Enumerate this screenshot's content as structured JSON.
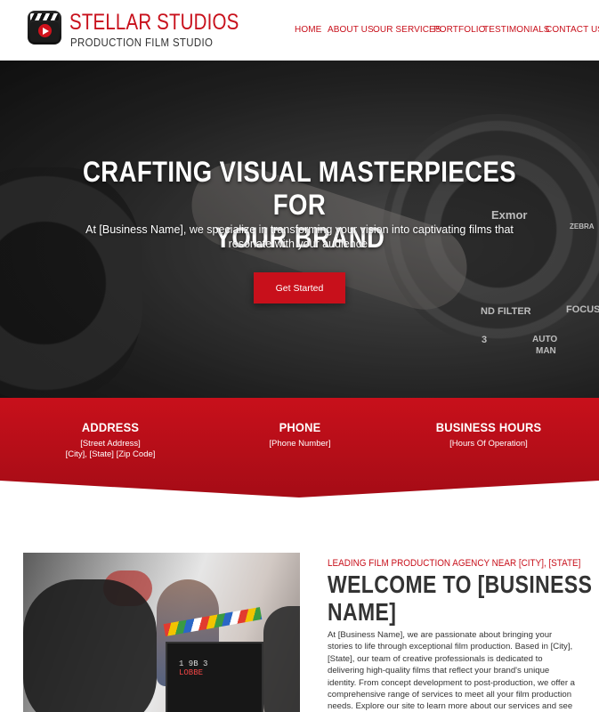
{
  "brand": {
    "name": "STELLAR STUDIOS",
    "tagline": "PRODUCTION FILM STUDIO"
  },
  "nav": {
    "items": [
      "HOME",
      "ABOUT US",
      "OUR SERVICES",
      "PORTFOLIO",
      "TESTIMONIALS",
      "CONTACT US"
    ]
  },
  "hero": {
    "title_line1": "CRAFTING VISUAL MASTERPIECES FOR",
    "title_line2": "YOUR BRAND",
    "intro": "At [Business Name], we specialize in transforming your vision into captivating films that resonate with your audience.",
    "cta_label": "Get Started",
    "camera_labels": [
      "Exmor",
      "ZEBRA",
      "ND FILTER",
      "FOCUS",
      "3",
      "AUTO",
      "MAN"
    ]
  },
  "info": {
    "address": {
      "title": "ADDRESS",
      "line1": "[Street Address]",
      "line2": "[City], [State] [Zip Code]"
    },
    "phone": {
      "title": "PHONE",
      "line1": "[Phone Number]"
    },
    "hours": {
      "title": "BUSINESS HOURS",
      "line1": "[Hours Of Operation]"
    }
  },
  "welcome": {
    "kicker": "LEADING FILM PRODUCTION AGENCY NEAR [CITY], [STATE]",
    "title_line1": "WELCOME TO [BUSINESS",
    "title_line2": "NAME]",
    "body": "At [Business Name], we are passionate about bringing your stories to life through exceptional film production. Based in [City], [State], our team of creative professionals is dedicated to delivering high-quality films that reflect your brand's unique identity. From concept development to post-production, we offer a comprehensive range of services to meet all your film production needs. Explore our site to learn more about our services and see how we can help elevate your",
    "slate_text": [
      "1   9B   3",
      "LOBBE"
    ]
  },
  "colors": {
    "accent": "#c8101b",
    "accent_dark": "#a50c16",
    "text": "#333333"
  }
}
